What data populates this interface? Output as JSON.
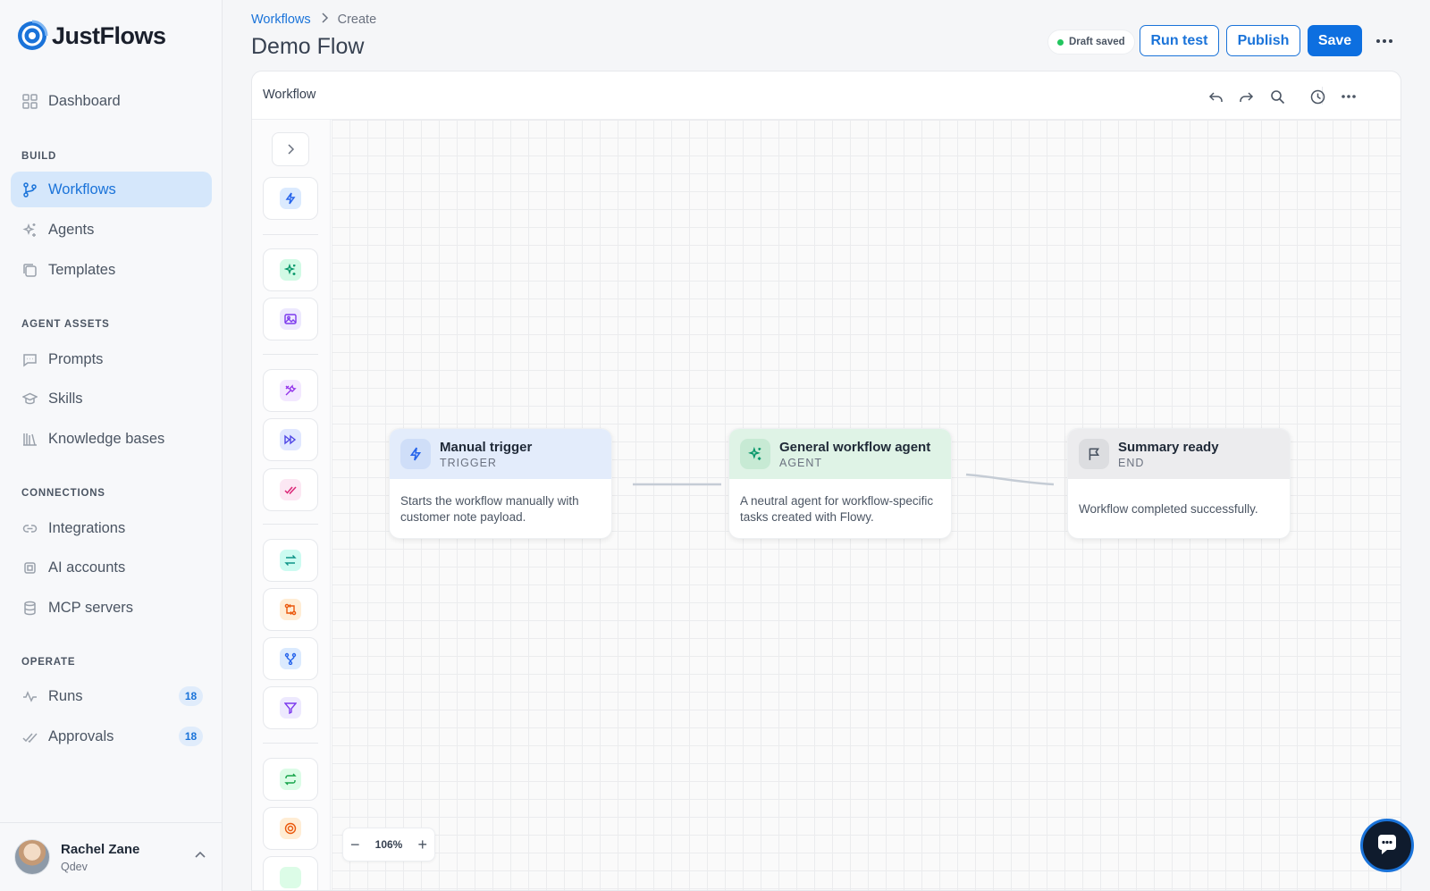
{
  "app": {
    "name": "JustFlows",
    "brand_color": "#1a73d9"
  },
  "sidebar": {
    "dashboard": "Dashboard",
    "sections": {
      "build": "BUILD",
      "agent_assets": "AGENT ASSETS",
      "connections": "CONNECTIONS",
      "operate": "OPERATE"
    },
    "items": {
      "workflows": "Workflows",
      "agents": "Agents",
      "templates": "Templates",
      "prompts": "Prompts",
      "skills": "Skills",
      "knowledge_bases": "Knowledge bases",
      "integrations": "Integrations",
      "ai_accounts": "AI accounts",
      "mcp_servers": "MCP servers",
      "runs": "Runs",
      "approvals": "Approvals"
    },
    "badges": {
      "runs": "18",
      "approvals": "18"
    },
    "user": {
      "name": "Rachel Zane",
      "org": "Qdev"
    }
  },
  "header": {
    "breadcrumb": {
      "parent": "Workflows",
      "current": "Create"
    },
    "title": "Demo Flow",
    "status": "Draft saved",
    "run_test": "Run test",
    "publish": "Publish",
    "save": "Save"
  },
  "canvas": {
    "panel_title": "Workflow",
    "zoom": "106%",
    "nodes": [
      {
        "title": "Manual trigger",
        "type": "TRIGGER",
        "body": "Starts the workflow manually with customer note payload."
      },
      {
        "title": "General workflow agent",
        "type": "AGENT",
        "body": "A neutral agent for workflow-specific tasks created with Flowy."
      },
      {
        "title": "Summary ready",
        "type": "END",
        "body": "Workflow completed successfully."
      }
    ]
  }
}
